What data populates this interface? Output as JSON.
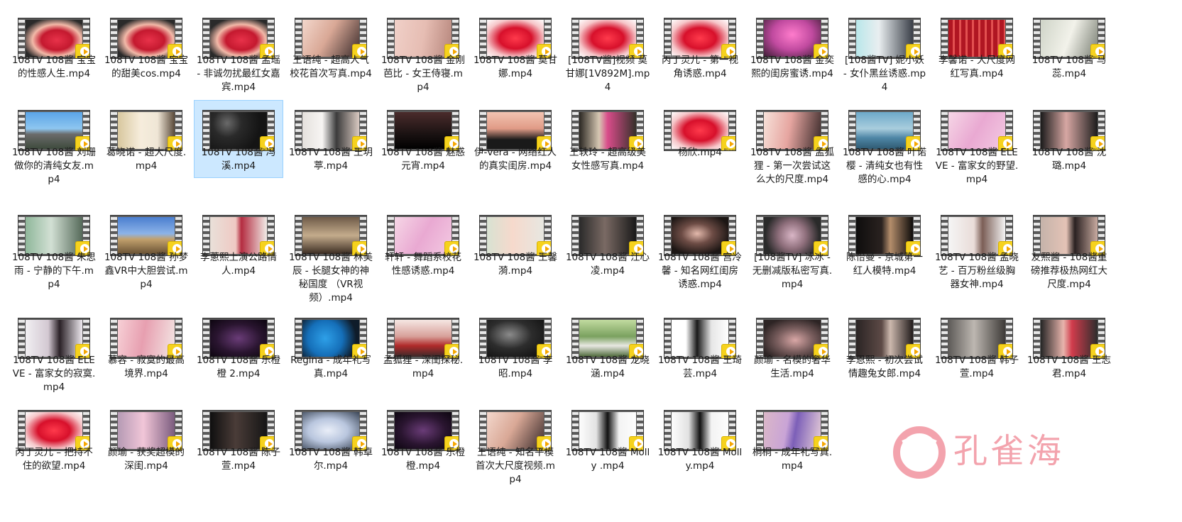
{
  "window": {
    "corner_glyph": "p"
  },
  "badge_label": "Player",
  "selected_index": 14,
  "files": [
    {
      "name": "108TV 108酱 宝宝的性感人生.mp4",
      "thumb": "lips-red"
    },
    {
      "name": "108TV 108酱 宝宝的甜美cos.mp4",
      "thumb": "lips-red"
    },
    {
      "name": "108TV 108酱 孟瑶 - 非诚勿扰最红女嘉宾.mp4",
      "thumb": "lips-red"
    },
    {
      "name": "王语纯 - 超高人气校花首次写真.mp4",
      "thumb": "skin"
    },
    {
      "name": "108TV 108酱 金刚芭比 - 女王侍寝.mp4",
      "thumb": "skin-pale"
    },
    {
      "name": "108TV 108酱 莫甘娜.mp4",
      "thumb": "lips-bright"
    },
    {
      "name": "[108TV酱]视频 莫甘娜[1V892M].mp4",
      "thumb": "lips-bright"
    },
    {
      "name": "丙丁灵儿 - 第一视角诱惑.mp4",
      "thumb": "lips-bright"
    },
    {
      "name": "108TV 108酱 金奕熙的闺房蜜诱.mp4",
      "thumb": "pink-room"
    },
    {
      "name": "[108酱TV] 妮小妖 - 女仆黑丝诱惑.mp4",
      "thumb": "girl-teal"
    },
    {
      "name": "李馨诺 - 大尺度网红写真.mp4",
      "thumb": "red-cage"
    },
    {
      "name": "108TV 108酱 马蕊.mp4",
      "thumb": "pale-cloth"
    },
    {
      "name": "108TV 108酱 刘珊做你的清纯女友.mp4",
      "thumb": "city"
    },
    {
      "name": "葛晓诺 - 超大尺度.mp4",
      "thumb": "room-light"
    },
    {
      "name": "108TV 108酱 冯溪.mp4",
      "thumb": "dark-grain"
    },
    {
      "name": "108TV 108酱 王玥葶.mp4",
      "thumb": "lace"
    },
    {
      "name": "108TV 108酱 魅惑元宵.mp4",
      "thumb": "dark-legs"
    },
    {
      "name": "伊-vera - 网络红人的真实闺房.mp4",
      "thumb": "black-lace"
    },
    {
      "name": "王轶玲 - 超高级美女性感写真.mp4",
      "thumb": "doorway"
    },
    {
      "name": "杨欣.mp4",
      "thumb": "lips-bright"
    },
    {
      "name": "108TV 108酱 孟狐狸 - 第一次尝试这么大的尺度.mp4",
      "thumb": "face-pink"
    },
    {
      "name": "108TV 108酱 叶诺樱 - 清纯女也有性感的心.mp4",
      "thumb": "sky"
    },
    {
      "name": "108TV 108酱 ELEVE - 富家女的野望.mp4",
      "thumb": "pink-soft"
    },
    {
      "name": "108TV 108酱 沈璐.mp4",
      "thumb": "face-dark"
    },
    {
      "name": "108TV 108酱 朱思雨 - 宁静的下午.mp4",
      "thumb": "window-green"
    },
    {
      "name": "108TV 108酱 孙梦鑫VR中大胆尝试.mp4",
      "thumb": "panorama"
    },
    {
      "name": "李蔥熙上演公路情人.mp4",
      "thumb": "bikini"
    },
    {
      "name": "108TV 108酱 林美辰 - 长腿女神的神秘国度 （VR视频）.mp4",
      "thumb": "vr-room"
    },
    {
      "name": "轩轩 - 舞蹈系校花性感诱惑.mp4",
      "thumb": "pink-soft"
    },
    {
      "name": "108TV 108酱 王馨漪.mp4",
      "thumb": "girl-floral"
    },
    {
      "name": "108TV 108酱 江心凌.mp4",
      "thumb": "dark-hair"
    },
    {
      "name": "108TV 108酱 宫冷馨 - 知名网红闺房诱惑.mp4",
      "thumb": "dark-room"
    },
    {
      "name": "[108酱TV] 冰冰 - 无删减版私密写真.mp4",
      "thumb": "mono-lace"
    },
    {
      "name": "陈怡曼 - 京城第一红人模特.mp4",
      "thumb": "dark-figure"
    },
    {
      "name": "108TV 108酱 孟晓艺 - 百万粉丝级胸器女神.mp4",
      "thumb": "white-room"
    },
    {
      "name": "友熙酱 - 108酱重磅推荐极热网红大尺度.mp4",
      "thumb": "glasses"
    },
    {
      "name": "108TV 108酱 ELEVE - 富家女的寂寞.mp4",
      "thumb": "sitting"
    },
    {
      "name": "慕容 - 寂寞的最高境界.mp4",
      "thumb": "bed-pink"
    },
    {
      "name": "108TV 108酱 乐橙橙 2.mp4",
      "thumb": "purple-dark"
    },
    {
      "name": "Regina - 成年礼写真.mp4",
      "thumb": "blue-ball"
    },
    {
      "name": "孟狐狸 - 深闺探秘.mp4",
      "thumb": "lying"
    },
    {
      "name": "108TV 108酱 李昭.mp4",
      "thumb": "dark-mono"
    },
    {
      "name": "108TV 108酱 龙晓涵.mp4",
      "thumb": "garden"
    },
    {
      "name": "108TV 108酱 王琦芸.mp4",
      "thumb": "black-white"
    },
    {
      "name": "颜瑜 - 名模的奢华生活.mp4",
      "thumb": "pink-blur"
    },
    {
      "name": "李恩熙 - 初次尝试情趣兔女郎.mp4",
      "thumb": "dark-stand"
    },
    {
      "name": "108TV 108酱 韩子萱.mp4",
      "thumb": "legs-grey"
    },
    {
      "name": "108TV 108酱 王志君.mp4",
      "thumb": "face-red"
    },
    {
      "name": "丙丁灵儿 – 把持不住的欲望.mp4",
      "thumb": "lips-bright"
    },
    {
      "name": "颜瑜 - 获奖超模的深闺.mp4",
      "thumb": "pink-hair"
    },
    {
      "name": "108TV 108酱 陈子萱.mp4",
      "thumb": "dark-pole"
    },
    {
      "name": "108TV 108酱 韩卓尔.mp4",
      "thumb": "pale-blue"
    },
    {
      "name": "108TV 108酱 乐橙橙.mp4",
      "thumb": "purple-dark"
    },
    {
      "name": "王语纯 - 知名平模首次大尺度视频.mp4",
      "thumb": "skin"
    },
    {
      "name": "108TV 108酱 Molly .mp4",
      "thumb": "stockings"
    },
    {
      "name": "108TV 108酱 Molly.mp4",
      "thumb": "stockings"
    },
    {
      "name": "桐桐 - 成年礼写真.mp4",
      "thumb": "tattoo"
    }
  ],
  "watermark": {
    "text": "孔雀海",
    "logo_chars": "孔雀"
  },
  "thumb_styles": {
    "lips-red": "radial-gradient(ellipse at 55% 55%, #e8324a 0%, #c4192f 35%, #f2b9a8 55%, #2a2a2a 80%)",
    "lips-bright": "radial-gradient(ellipse at 50% 50%, #ff3a4c 0%, #d7102b 40%, #f6c6c9 72%, #ffffff 100%)",
    "skin": "linear-gradient(120deg, #f3d7cc 0%, #d9a896 45%, #3a2b2b 100%)",
    "skin-pale": "linear-gradient(100deg, #f0d0c8 0%, #e6bdb3 50%, #b6867c 100%)",
    "pink-room": "radial-gradient(ellipse at 50% 40%, #ff7ccc 0%, #c04a9f 50%, #3b1c33 100%)",
    "girl-teal": "linear-gradient(90deg, #b9e7ea 0%, #e9eef0 40%, #3a3f48 100%)",
    "red-cage": "repeating-linear-gradient(90deg, #b01622 0px, #b01622 6px, #e25050 6px, #e25050 9px)",
    "pale-cloth": "linear-gradient(110deg, #cfd4c8 0%, #f2f2ea 50%, #7a7f74 100%)",
    "city": "linear-gradient(180deg, #5aa4e6 0%, #8ec6f0 45%, #6b6b6b 60%, #3d4a3c 100%)",
    "room-light": "linear-gradient(90deg, #d8c79e 0%, #f6eddc 40%, #efe6d6 70%, #5a4a3a 100%)",
    "dark-grain": "radial-gradient(circle at 30% 30%, #6a6a6a 0%, #2a2a2a 30%, #141414 70%)",
    "lace": "linear-gradient(90deg, #e5e1dd 0%, #f7f5f3 35%, #3b3b3b 60%, #d9c9c1 100%)",
    "dark-legs": "linear-gradient(180deg, #4b2c2c 0%, #1a1212 60%, #000000 100%)",
    "black-lace": "linear-gradient(180deg, #f3c4b2 0%, #e09b86 45%, #1a1a1a 75%)",
    "doorway": "linear-gradient(90deg, #2b2722 0%, #d6c8b3 35%, #d94c8a 50%, #35302a 100%)",
    "face-pink": "linear-gradient(100deg, #f7e1d9 0%, #e6a5a0 45%, #3a2a2a 100%)",
    "sky": "linear-gradient(180deg, #6da9c9 0%, #a9cddd 45%, #4e86a6 70%, #2f5a72 100%)",
    "pink-soft": "linear-gradient(120deg, #f6d6e6 0%, #e9a9d2 50%, #f3c9e2 100%)",
    "face-dark": "linear-gradient(90deg, #1b1b1b 0%, #d7a7a3 45%, #1c1c1c 100%)",
    "window-green": "linear-gradient(90deg, #8fb79a 0%, #d2e0d4 45%, #566a5a 100%)",
    "panorama": "linear-gradient(180deg, #4a7ecf 0%, #8cb3e8 45%, #c2a16d 60%, #6a5234 100%)",
    "bikini": "linear-gradient(90deg, #e9e0d9 0%, #efc9c3 45%, #b42c40 55%, #f0ebe7 100%)",
    "vr-room": "linear-gradient(180deg, #6e5a48 0%, #c4ac8c 50%, #3b2c22 100%)",
    "girl-floral": "linear-gradient(90deg, #d8e2d2 0%, #f6d9cc 45%, #e7e7e1 100%)",
    "dark-hair": "linear-gradient(90deg, #2a2a2a 0%, #7a6a64 45%, #191919 100%)",
    "dark-room": "radial-gradient(ellipse at 45% 45%, #e3b9ac 0%, #6d4c45 35%, #1c1614 75%)",
    "mono-lace": "radial-gradient(circle at 50% 50%, #d9b6c6 0%, #8f6f7c 40%, #2a2a2a 80%)",
    "dark-figure": "linear-gradient(90deg, #0e0d0d 0%, #2a2220 45%, #b58e6c 60%, #0d0b0a 100%)",
    "white-room": "linear-gradient(90deg, #f5f5f5 0%, #e9dcd8 45%, #7b5e56 60%, #f3f3f3 100%)",
    "glasses": "linear-gradient(90deg, #c5b3aa 0%, #e4c3b6 45%, #2a2121 60%, #c8aaa0 100%)",
    "sitting": "linear-gradient(90deg, #f1eff2 0%, #d3c8d2 40%, #2a2127 60%, #ede8ee 100%)",
    "bed-pink": "linear-gradient(100deg, #f7d0d6 0%, #e79fb0 45%, #f3e6e4 100%)",
    "purple-dark": "radial-gradient(ellipse at 50% 50%, #6a3c78 0%, #2a1530 55%, #0c050f 100%)",
    "blue-ball": "radial-gradient(circle at 40% 50%, #2ea0e8 0%, #156fb9 45%, #0f1c2a 80%)",
    "lying": "linear-gradient(180deg, #f6e7e3 0%, #d7a09a 45%, #b02a2a 70%, #3b2a2a 100%)",
    "dark-mono": "radial-gradient(ellipse at 40% 40%, #8b8b8b 0%, #2d2d2d 45%, #0b0b0b 100%)",
    "garden": "linear-gradient(180deg, #c2dba0 0%, #7aa15f 45%, #e8e8e2 70%, #4e6a3a 100%)",
    "black-white": "linear-gradient(90deg, #ffffff 0%, #ffffff 25%, #1a1a1a 45%, #e6e6e6 70%, #ffffff 100%)",
    "pink-blur": "radial-gradient(ellipse at 55% 55%, #d9a7a6 0%, #7b5f5f 40%, #2d2424 80%)",
    "dark-stand": "linear-gradient(90deg, #2a2424 0%, #5d4a46 45%, #cdb9ae 60%, #211b1b 100%)",
    "legs-grey": "linear-gradient(90deg, #5e5b58 0%, #bdb7b1 45%, #3d3a37 100%)",
    "face-red": "linear-gradient(90deg, #262626 0%, #e8b4ac 40%, #d13c4c 55%, #2d2d2d 100%)",
    "pink-hair": "linear-gradient(90deg, #b59ab4 0%, #f1c6d8 45%, #7b5c7e 100%)",
    "dark-pole": "linear-gradient(90deg, #0f0f0f 0%, #4a3c38 45%, #151515 100%)",
    "pale-blue": "radial-gradient(ellipse at 45% 50%, #e9eef8 0%, #b9c6de 45%, #3a4556 100%)",
    "stockings": "linear-gradient(90deg, #fdfdfd 0%, #e2e2e2 30%, #111111 50%, #f3f3f3 70%, #fdfdfd 100%)",
    "tattoo": "linear-gradient(100deg, #dbb7c8 0%, #c9a4d6 40%, #7c5fb8 55%, #e8cfd8 100%)"
  }
}
